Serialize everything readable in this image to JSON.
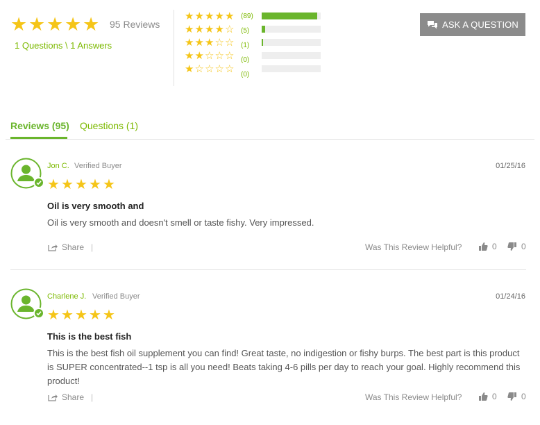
{
  "summary": {
    "rating": 5,
    "review_count_label": "95 Reviews",
    "qa_link_label": "1 Questions \\ 1 Answers"
  },
  "histogram": [
    {
      "stars": 5,
      "count_label": "(89)",
      "fraction": 0.94
    },
    {
      "stars": 4,
      "count_label": "(5)",
      "fraction": 0.06
    },
    {
      "stars": 3,
      "count_label": "(1)",
      "fraction": 0.02
    },
    {
      "stars": 2,
      "count_label": "(0)",
      "fraction": 0
    },
    {
      "stars": 1,
      "count_label": "(0)",
      "fraction": 0
    }
  ],
  "ask_button_label": "ASK A QUESTION",
  "tabs": {
    "reviews_label": "Reviews (95)",
    "questions_label": "Questions (1)"
  },
  "colors": {
    "accent": "#6ab52c",
    "star": "#f5c518",
    "button": "#8b8b8b"
  },
  "reviews": [
    {
      "name": "Jon C.",
      "verified": "Verified Buyer",
      "date": "01/25/16",
      "rating": 5,
      "title": "Oil is very smooth and",
      "body": "Oil is very smooth and doesn't smell or taste fishy. Very impressed.",
      "share_label": "Share",
      "separator": "|",
      "helpful_label": "Was This Review Helpful?",
      "up_votes": "0",
      "down_votes": "0"
    },
    {
      "name": "Charlene J.",
      "verified": "Verified Buyer",
      "date": "01/24/16",
      "rating": 5,
      "title": "This is the best fish",
      "body": "This is the best fish oil supplement you can find! Great taste, no indigestion or fishy burps. The best part is this product is SUPER concentrated--1 tsp is all you need! Beats taking 4-6 pills per day to reach your goal. Highly recommend this product!",
      "share_label": "Share",
      "separator": "|",
      "helpful_label": "Was This Review Helpful?",
      "up_votes": "0",
      "down_votes": "0"
    }
  ]
}
